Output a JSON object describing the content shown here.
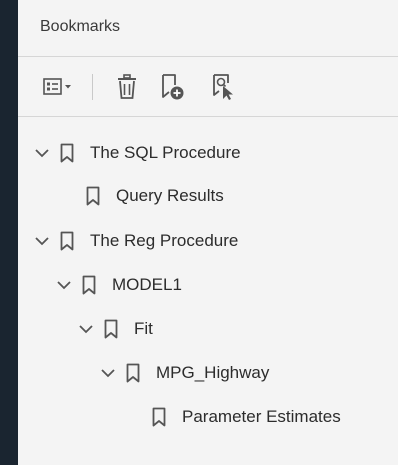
{
  "panel": {
    "title": "Bookmarks"
  },
  "toolbar": {
    "buttons": [
      {
        "name": "options-menu",
        "icon": "list-options-icon"
      },
      {
        "name": "delete-bookmark",
        "icon": "trash-icon"
      },
      {
        "name": "new-bookmark",
        "icon": "add-bookmark-icon"
      },
      {
        "name": "find-bookmark",
        "icon": "find-current-bookmark-icon"
      }
    ]
  },
  "tree": {
    "items": [
      {
        "label": "The SQL Procedure",
        "level": 0,
        "expanded": true,
        "has_children": true
      },
      {
        "label": "Query Results",
        "level": 1,
        "expanded": false,
        "has_children": false
      },
      {
        "label": "The Reg Procedure",
        "level": 0,
        "expanded": true,
        "has_children": true
      },
      {
        "label": "MODEL1",
        "level": 1,
        "expanded": true,
        "has_children": true
      },
      {
        "label": "Fit",
        "level": 2,
        "expanded": true,
        "has_children": true
      },
      {
        "label": "MPG_Highway",
        "level": 3,
        "expanded": true,
        "has_children": true
      },
      {
        "label": "Parameter Estimates",
        "level": 4,
        "expanded": false,
        "has_children": false
      }
    ]
  },
  "colors": {
    "panel_bg": "#f4f4f4",
    "page_bg": "#1a2530",
    "icon": "#555555",
    "text": "#2c2c2c"
  }
}
